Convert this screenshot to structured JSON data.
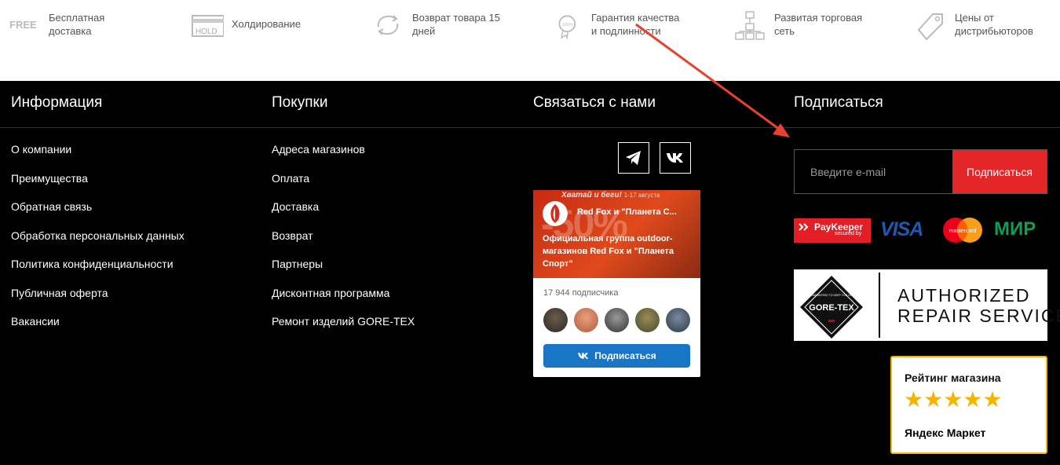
{
  "features": [
    {
      "icon": "free-delivery-icon",
      "text": "Бесплатная доставка",
      "line1": "Бесплатная",
      "line2": "доставка"
    },
    {
      "icon": "hold-icon",
      "text": "Холдирование",
      "line1": "Холдирование",
      "line2": ""
    },
    {
      "icon": "return-arrows-icon",
      "text": "Возврат товара 15 дней",
      "line1": "Возврат товара 15",
      "line2": "дней"
    },
    {
      "icon": "quality-seal-icon",
      "text": "Гарантия качества и подлинности",
      "line1": "Гарантия качества",
      "line2": "и подлинности"
    },
    {
      "icon": "network-icon",
      "text": "Развитая торговая сеть",
      "line1": "Развитая торговая",
      "line2": "сеть"
    },
    {
      "icon": "price-tag-icon",
      "text": "Цены от дистрибьюторов",
      "line1": "Цены от",
      "line2": "дистрибьюторов"
    }
  ],
  "hold_badge": "HOLD",
  "free_badge": "FREE",
  "seal_badge": "100%",
  "columns": {
    "info": {
      "title": "Информация",
      "links": [
        "О компании",
        "Преимущества",
        "Обратная связь",
        "Обработка персональных данных",
        "Политика конфиденциальности",
        "Публичная оферта",
        "Вакансии"
      ]
    },
    "purchases": {
      "title": "Покупки",
      "links": [
        "Адреса магазинов",
        "Оплата",
        "Доставка",
        "Возврат",
        "Партнеры",
        "Дисконтная программа",
        "Ремонт изделий GORE-TEX"
      ]
    },
    "contact": {
      "title": "Связаться с нами"
    },
    "subscribe": {
      "title": "Подписаться"
    }
  },
  "social": {
    "icons": [
      "telegram-icon",
      "vk-icon"
    ]
  },
  "vk_widget": {
    "tagline": "Хватай и беги!",
    "date": "1-17 августа",
    "promo": "-50%",
    "group_name": "Red Fox и \"Планета С...",
    "group_desc": "Официальная группа outdoor-магазинов Red Fox и \"Планета Спорт\"",
    "subscribers": "17 944 подписчика",
    "button": "Подписаться"
  },
  "subscribe_form": {
    "placeholder": "Введите e-mail",
    "button": "Подписаться"
  },
  "payments": {
    "paykeeper": "PayKeeper",
    "paykeeper_sub": "secured by",
    "visa": "VISA",
    "mastercard": "mastercard",
    "mir": "МИР"
  },
  "goretex": {
    "emblem": "GORE-TEX",
    "emblem_top": "GUARANTEED TO KEEP YOU DRY",
    "line1": "AUTHORIZED",
    "line2": "REPAIR SERVICE"
  },
  "rating": {
    "title": "Рейтинг магазина",
    "stars": "★★★★★",
    "source": "Яндекс Маркет"
  },
  "colors": {
    "accent": "#e52628",
    "vk_blue": "#1976c6",
    "star": "#f4b400",
    "arrow": "#e8412f"
  }
}
